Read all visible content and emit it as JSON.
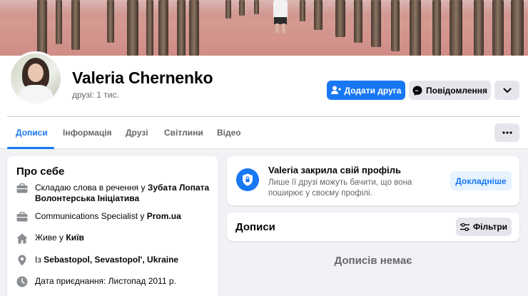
{
  "profile": {
    "name": "Valeria Chernenko",
    "friends": "друзі: 1 тис."
  },
  "actions": {
    "add_friend": "Додати друга",
    "message": "Повідомлення"
  },
  "tabs": [
    {
      "label": "Дописи",
      "active": true
    },
    {
      "label": "Інформація",
      "active": false
    },
    {
      "label": "Друзі",
      "active": false
    },
    {
      "label": "Світлини",
      "active": false
    },
    {
      "label": "Відео",
      "active": false
    }
  ],
  "about": {
    "title": "Про себе",
    "work1_prefix": "Складаю слова в речення у ",
    "work1_org": "Зубата Лопата Волонтерська Ініціатива",
    "work2_prefix": "Communications Specialist у ",
    "work2_org": "Prom.ua",
    "lives_prefix": "Живе у ",
    "lives_city": "Київ",
    "from_prefix": "Із ",
    "from_place": "Sebastopol, Sevastopol', Ukraine",
    "joined": "Дата приєднання: Листопад 2011 р."
  },
  "locked": {
    "title": "Valeria закрила свій профіль",
    "description": "Лише її друзі можуть бачити, що вона поширює у своєму профілі.",
    "learn_more": "Докладніше"
  },
  "posts": {
    "title": "Дописи",
    "filters": "Фільтри",
    "empty": "Дописів немає"
  },
  "colors": {
    "accent": "#1877f2",
    "background": "#f0f2f5",
    "secondary_button": "#e4e6eb",
    "muted_text": "#65676b"
  },
  "icons": [
    "add-friend-icon",
    "messenger-icon",
    "chevron-down-icon",
    "more-dots-icon",
    "briefcase-icon",
    "home-icon",
    "location-pin-icon",
    "clock-icon",
    "shield-icon",
    "filter-icon"
  ]
}
